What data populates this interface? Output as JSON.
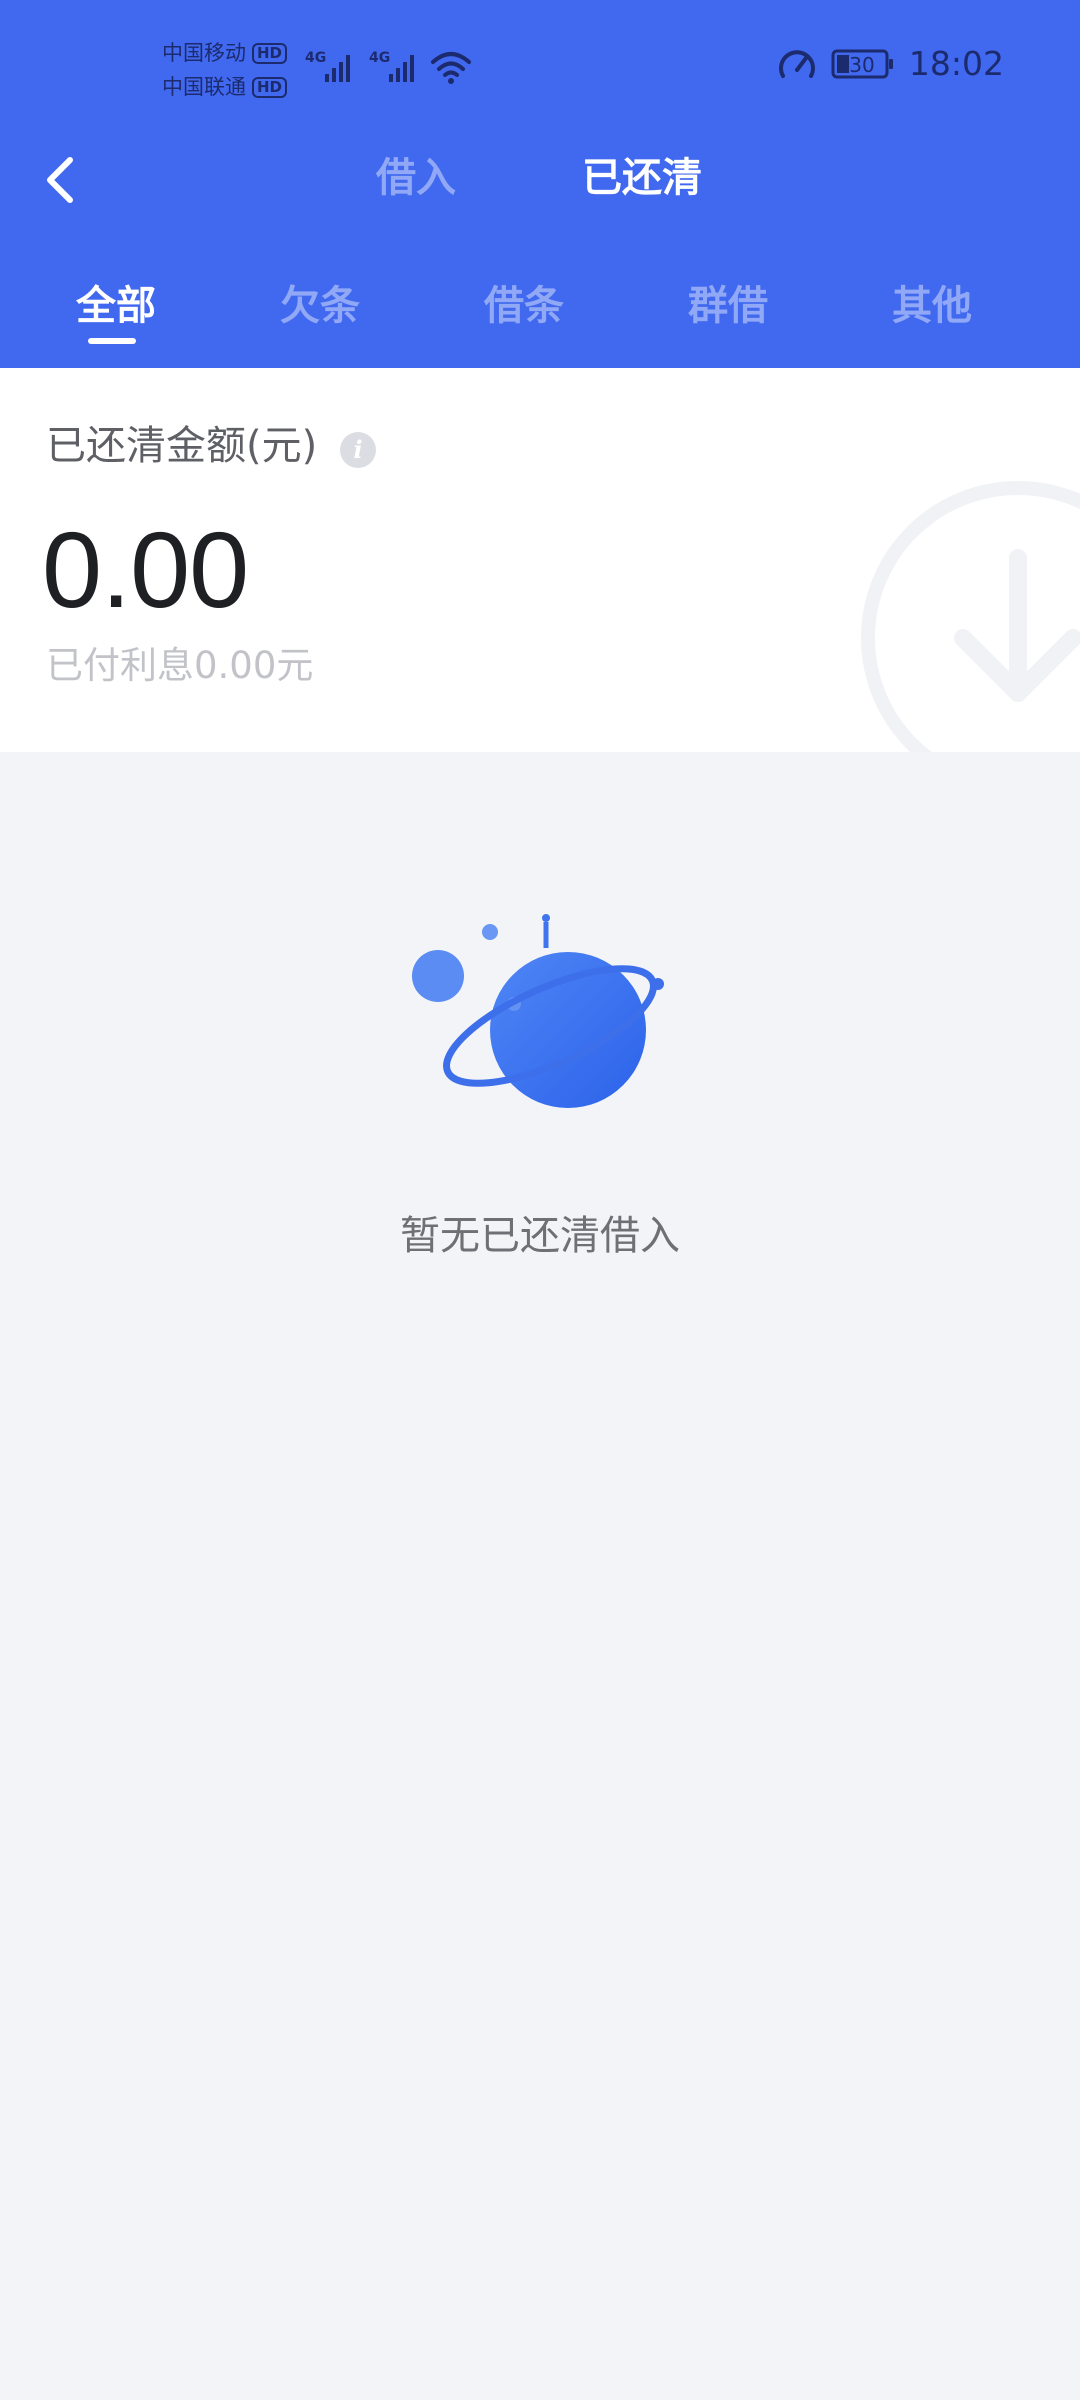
{
  "status_bar": {
    "carrier_1": "中国移动",
    "carrier_2": "中国联通",
    "hd": "HD",
    "network_1": "4G",
    "network_2": "4G",
    "battery": "30",
    "time": "18:02"
  },
  "nav": {
    "tabs": [
      "借入",
      "已还清"
    ],
    "active_tab": "已还清"
  },
  "category_tabs": [
    "全部",
    "欠条",
    "借条",
    "群借",
    "其他"
  ],
  "active_category": "全部",
  "summary": {
    "label": "已还清金额(元)",
    "amount": "0.00",
    "interest": "已付利息0.00元"
  },
  "empty_state": {
    "message": "暂无已还清借入"
  },
  "colors": {
    "header_bg": "#4169ef",
    "page_bg": "#f3f4f8",
    "accent": "#3d6bf0"
  },
  "icons": {
    "back": "chevron-left-icon",
    "info": "info-icon",
    "watermark": "arrow-down-circle-icon",
    "empty": "planet-illustration-icon"
  }
}
